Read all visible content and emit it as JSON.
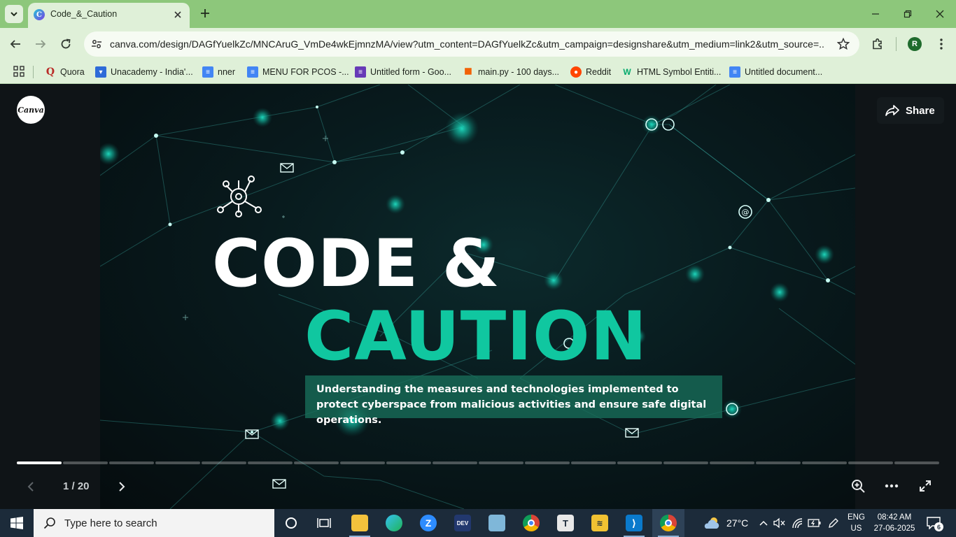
{
  "browser": {
    "tab_title": "Code_&_Caution",
    "url": "canva.com/design/DAGfYuelkZc/MNCAruG_VmDe4wkEjmnzMA/view?utm_content=DAGfYuelkZc&utm_campaign=designshare&utm_medium=link2&utm_source=...",
    "profile_initial": "R",
    "bookmarks": [
      {
        "label": "Quora",
        "icon": "quora-icon",
        "color": "#b92b27"
      },
      {
        "label": "Unacademy - India'...",
        "icon": "unacademy-icon",
        "color": "#3c4852"
      },
      {
        "label": "nner",
        "icon": "docs-icon",
        "color": "#4285f4"
      },
      {
        "label": "MENU FOR PCOS -...",
        "icon": "docs-icon",
        "color": "#4285f4"
      },
      {
        "label": "Untitled form - Goo...",
        "icon": "forms-icon",
        "color": "#673ab7"
      },
      {
        "label": "main.py - 100 days...",
        "icon": "replit-icon",
        "color": "#f26207"
      },
      {
        "label": "Reddit",
        "icon": "reddit-icon",
        "color": "#ff4500"
      },
      {
        "label": "HTML Symbol Entiti...",
        "icon": "w3-icon",
        "color": "#04aa6d"
      },
      {
        "label": "Untitled document...",
        "icon": "docs-icon",
        "color": "#4285f4"
      }
    ]
  },
  "viewer": {
    "logo": "Canva",
    "share_label": "Share",
    "slide": {
      "title_line1": "CODE &",
      "title_line2": "CAUTION",
      "subtitle": "Understanding the measures and technologies implemented to protect cyberspace from malicious activities and ensure safe digital operations."
    },
    "current_page": 1,
    "total_pages": 20,
    "page_indicator": "1 / 20",
    "accent_color": "#10c7a0"
  },
  "taskbar": {
    "search_placeholder": "Type here to search",
    "weather_temp": "27°C",
    "lang_line1": "ENG",
    "lang_line2": "US",
    "time": "08:42 AM",
    "date": "27-06-2025",
    "notification_count": "6",
    "apps": [
      "task-view-icon",
      "file-explorer-icon",
      "edge-icon",
      "zoom-icon",
      "dev-icon",
      "notepad-icon",
      "chrome-icon",
      "typing-icon",
      "stack-icon",
      "vscode-icon",
      "chrome-profile-icon"
    ]
  }
}
